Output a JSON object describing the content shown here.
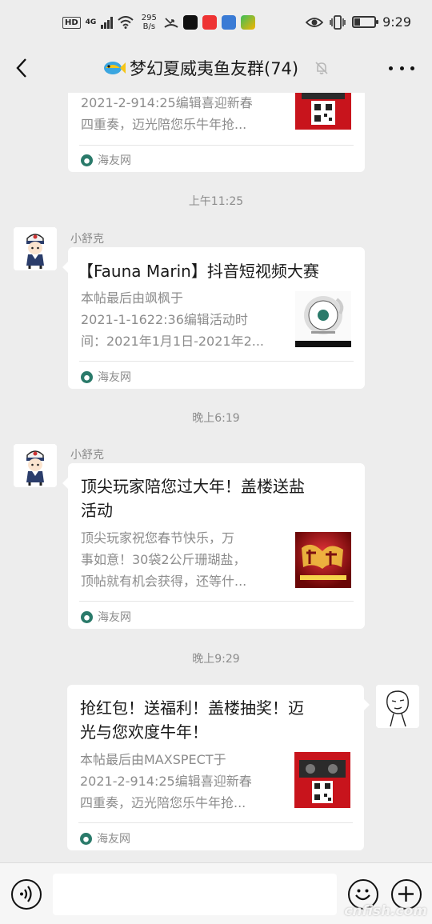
{
  "status_bar": {
    "network_badge": "HD",
    "network_type": "4G",
    "speed_value": "295",
    "speed_unit": "B/s",
    "time": "9:29",
    "battery_level_percent": 30
  },
  "header": {
    "title": "梦幻夏威夷鱼友群(74)"
  },
  "messages": [
    {
      "desc_lines": [
        "2021-2-914:25编辑喜迎新春",
        "四重奏，迈光陪您乐牛年抢..."
      ],
      "source": "海友网"
    },
    {
      "timestamp": "上午11:25",
      "sender": "小舒克",
      "title": "【Fauna Marin】抖音短视频大赛",
      "desc_lines": [
        "本帖最后由飒枫于",
        "2021-1-1622:36编辑活动时",
        "间：2021年1月1日-2021年2..."
      ],
      "source": "海友网"
    },
    {
      "timestamp": "晚上6:19",
      "sender": "小舒克",
      "title_lines": [
        "顶尖玩家陪您过大年！盖楼送盐",
        "活动"
      ],
      "desc_lines": [
        "顶尖玩家祝您春节快乐，万",
        "事如意！30袋2公斤珊瑚盐，",
        "顶帖就有机会获得，还等什..."
      ],
      "source": "海友网"
    },
    {
      "timestamp": "晚上9:29",
      "title_lines": [
        "抢红包！送福利！盖楼抽奖！迈",
        "光与您欢度牛年！"
      ],
      "desc_lines": [
        "本帖最后由MAXSPECT于",
        "2021-2-914:25编辑喜迎新春",
        "四重奏，迈光陪您乐牛年抢..."
      ],
      "source": "海友网"
    }
  ],
  "watermark": "cnfish.com",
  "colors": {
    "background": "#ededed",
    "card": "#ffffff",
    "secondary_text": "#8c8c8c",
    "primary_text": "#191919"
  }
}
